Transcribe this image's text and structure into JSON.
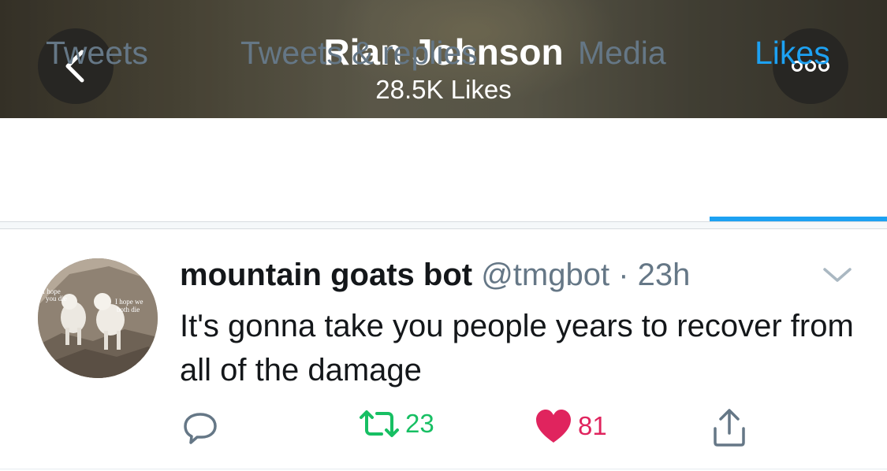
{
  "header": {
    "title": "Rian Johnson",
    "subtitle": "28.5K Likes",
    "back_icon": "chevron-left-icon",
    "more_icon": "more-horizontal-icon"
  },
  "tabs": [
    {
      "label": "Tweets",
      "active": false
    },
    {
      "label": "Tweets & replies",
      "active": false
    },
    {
      "label": "Media",
      "active": false
    },
    {
      "label": "Likes",
      "active": true
    }
  ],
  "tweet": {
    "name": "mountain goats bot",
    "handle": "@tmgbot",
    "separator": "·",
    "time": "23h",
    "text": "It's gonna take you people years to recover from all of the damage",
    "avatar": {
      "caption_left": [
        "I hope",
        "you die"
      ],
      "caption_right": [
        "I hope we",
        "both die"
      ]
    },
    "actions": {
      "reply_icon": "reply-icon",
      "retweet_icon": "retweet-icon",
      "retweet_count": "23",
      "like_icon": "heart-icon",
      "like_count": "81",
      "share_icon": "share-icon"
    }
  },
  "colors": {
    "accent": "#1da1f2",
    "retweet": "#17bf63",
    "like": "#e0245e",
    "secondary_text": "#657786"
  }
}
